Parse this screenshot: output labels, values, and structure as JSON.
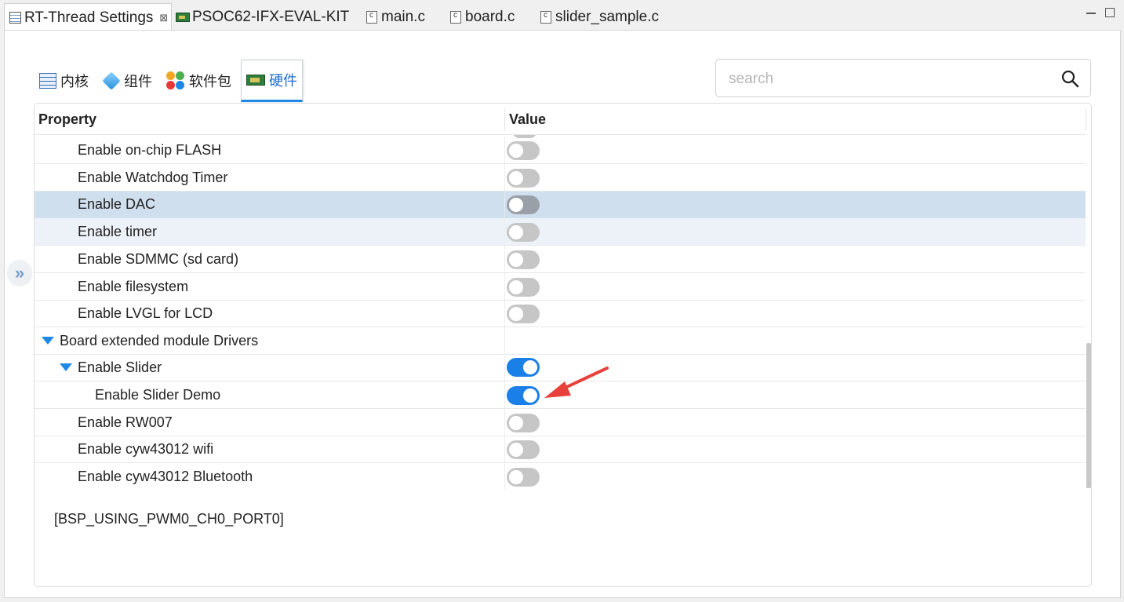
{
  "tabs": [
    {
      "label": "RT-Thread Settings",
      "close": "⊠"
    },
    {
      "label": "PSOC62-IFX-EVAL-KIT"
    },
    {
      "label": "main.c"
    },
    {
      "label": "board.c"
    },
    {
      "label": "slider_sample.c"
    }
  ],
  "category_tabs": [
    {
      "label": "内核"
    },
    {
      "label": "组件"
    },
    {
      "label": "软件包"
    },
    {
      "label": "硬件"
    }
  ],
  "search": {
    "placeholder": "search",
    "value": ""
  },
  "expander": "»",
  "table": {
    "headers": {
      "property": "Property",
      "value": "Value"
    },
    "rows": [
      {
        "label": "Enable on-chip FLASH",
        "toggle": "off"
      },
      {
        "label": "Enable Watchdog Timer",
        "toggle": "off"
      },
      {
        "label": "Enable DAC",
        "toggle": "off",
        "state": "selected"
      },
      {
        "label": "Enable timer",
        "toggle": "off",
        "state": "hover"
      },
      {
        "label": "Enable SDMMC (sd card)",
        "toggle": "off"
      },
      {
        "label": "Enable filesystem",
        "toggle": "off"
      },
      {
        "label": "Enable LVGL for LCD",
        "toggle": "off"
      },
      {
        "label": "Board extended module Drivers",
        "expanded": true
      },
      {
        "label": "Enable Slider",
        "toggle": "on",
        "expanded": true
      },
      {
        "label": "Enable Slider Demo",
        "toggle": "on"
      },
      {
        "label": "Enable RW007",
        "toggle": "off"
      },
      {
        "label": "Enable cyw43012 wifi",
        "toggle": "off"
      },
      {
        "label": "Enable cyw43012 Bluetooth",
        "toggle": "off"
      }
    ]
  },
  "description": "[BSP_USING_PWM0_CH0_PORT0]",
  "colors": {
    "accent": "#1a7fe6",
    "selected_row": "#cfdfee",
    "arrow": "#e8413b"
  }
}
